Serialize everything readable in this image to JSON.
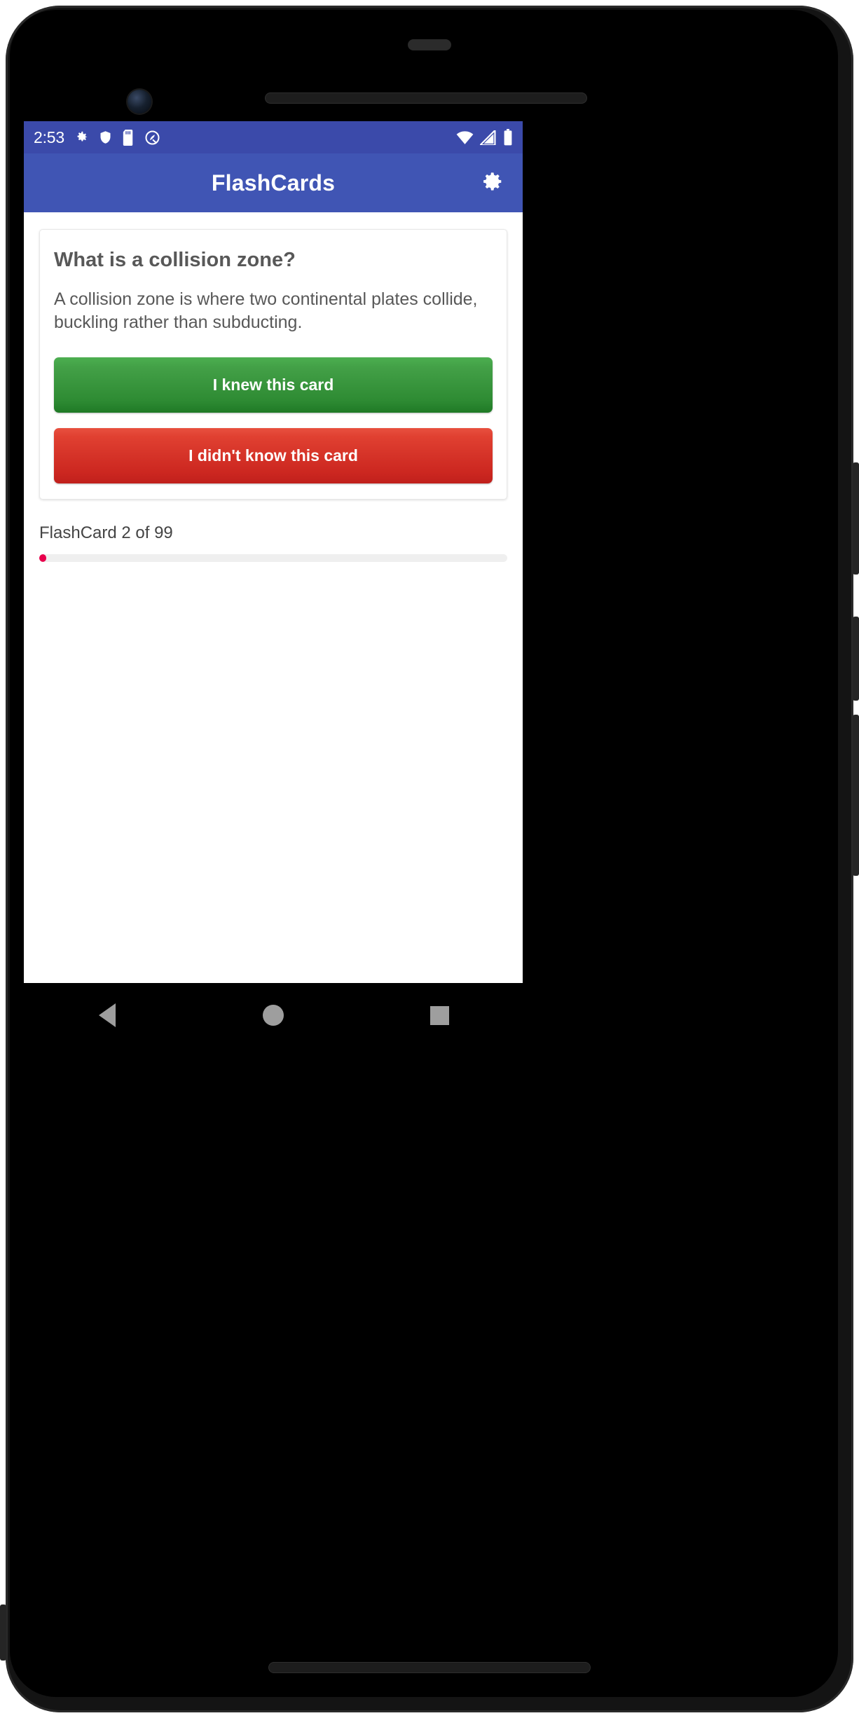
{
  "status_bar": {
    "clock": "2:53",
    "left_icons": [
      "gear-icon",
      "shield-icon",
      "sd-card-icon",
      "android-q-icon"
    ],
    "right_icons": [
      "wifi-icon",
      "cell-signal-icon",
      "battery-icon"
    ],
    "background_color": "#3b4aaa"
  },
  "app_bar": {
    "title": "FlashCards",
    "settings_icon": "gear-icon",
    "background_color": "#4055b4"
  },
  "card": {
    "question": "What is a collision zone?",
    "answer": "A collision zone is where two continental plates collide, buckling rather than subducting.",
    "knew_label": "I knew this card",
    "didnt_know_label": "I didn't know this card",
    "knew_color": "#2e8b33",
    "didnt_know_color": "#cc2720"
  },
  "progress": {
    "label": "FlashCard 2 of 99",
    "current": 2,
    "total": 99,
    "percent": 1.5,
    "fill_color": "#e8004c",
    "track_color": "#efefef"
  },
  "nav_bar": {
    "back": "back-triangle-icon",
    "home": "home-circle-icon",
    "recents": "recents-square-icon"
  }
}
